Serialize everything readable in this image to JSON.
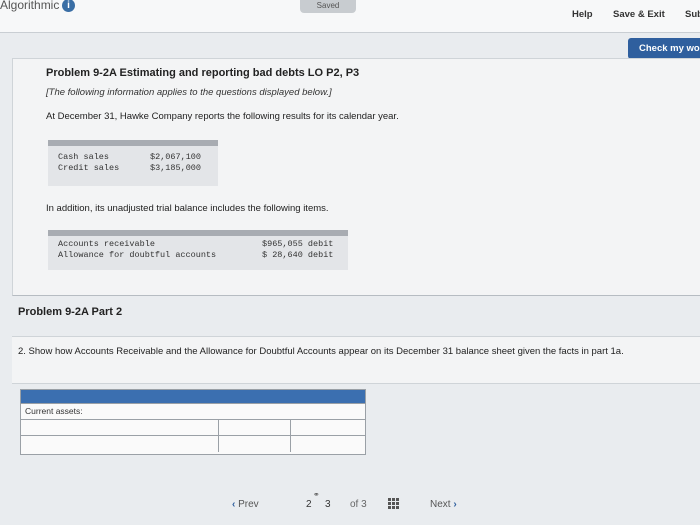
{
  "header": {
    "brand": "Algorithmic",
    "info_icon": "i",
    "saved": "Saved",
    "help": "Help",
    "save_exit": "Save & Exit",
    "submit": "Sub"
  },
  "check_button": "Check my wo",
  "problem": {
    "title": "Problem 9-2A Estimating and reporting bad debts LO P2, P3",
    "note": "[The following information applies to the questions displayed below.]",
    "intro": "At December 31, Hawke Company reports the following results for its calendar year.",
    "sales": [
      {
        "label": "Cash sales",
        "value": "$2,067,100"
      },
      {
        "label": "Credit sales",
        "value": "$3,185,000"
      }
    ],
    "intro2": "In addition, its unadjusted trial balance includes the following items.",
    "balances": [
      {
        "label": "Accounts receivable",
        "value": "$965,055 debit"
      },
      {
        "label": "Allowance for doubtful accounts",
        "value": "$ 28,640 debit"
      }
    ]
  },
  "part": {
    "title": "Problem 9-2A Part 2",
    "question": "2. Show how Accounts Receivable and the Allowance for Doubtful Accounts appear on its December 31 balance sheet given the facts in part 1a.",
    "first_row_label": "Current assets:"
  },
  "pager": {
    "prev": "Prev",
    "current": "2",
    "next_page": "3",
    "of": "of 3",
    "next": "Next"
  },
  "colors": {
    "accent": "#2f5f9e",
    "table_header": "#3b6fb0"
  }
}
